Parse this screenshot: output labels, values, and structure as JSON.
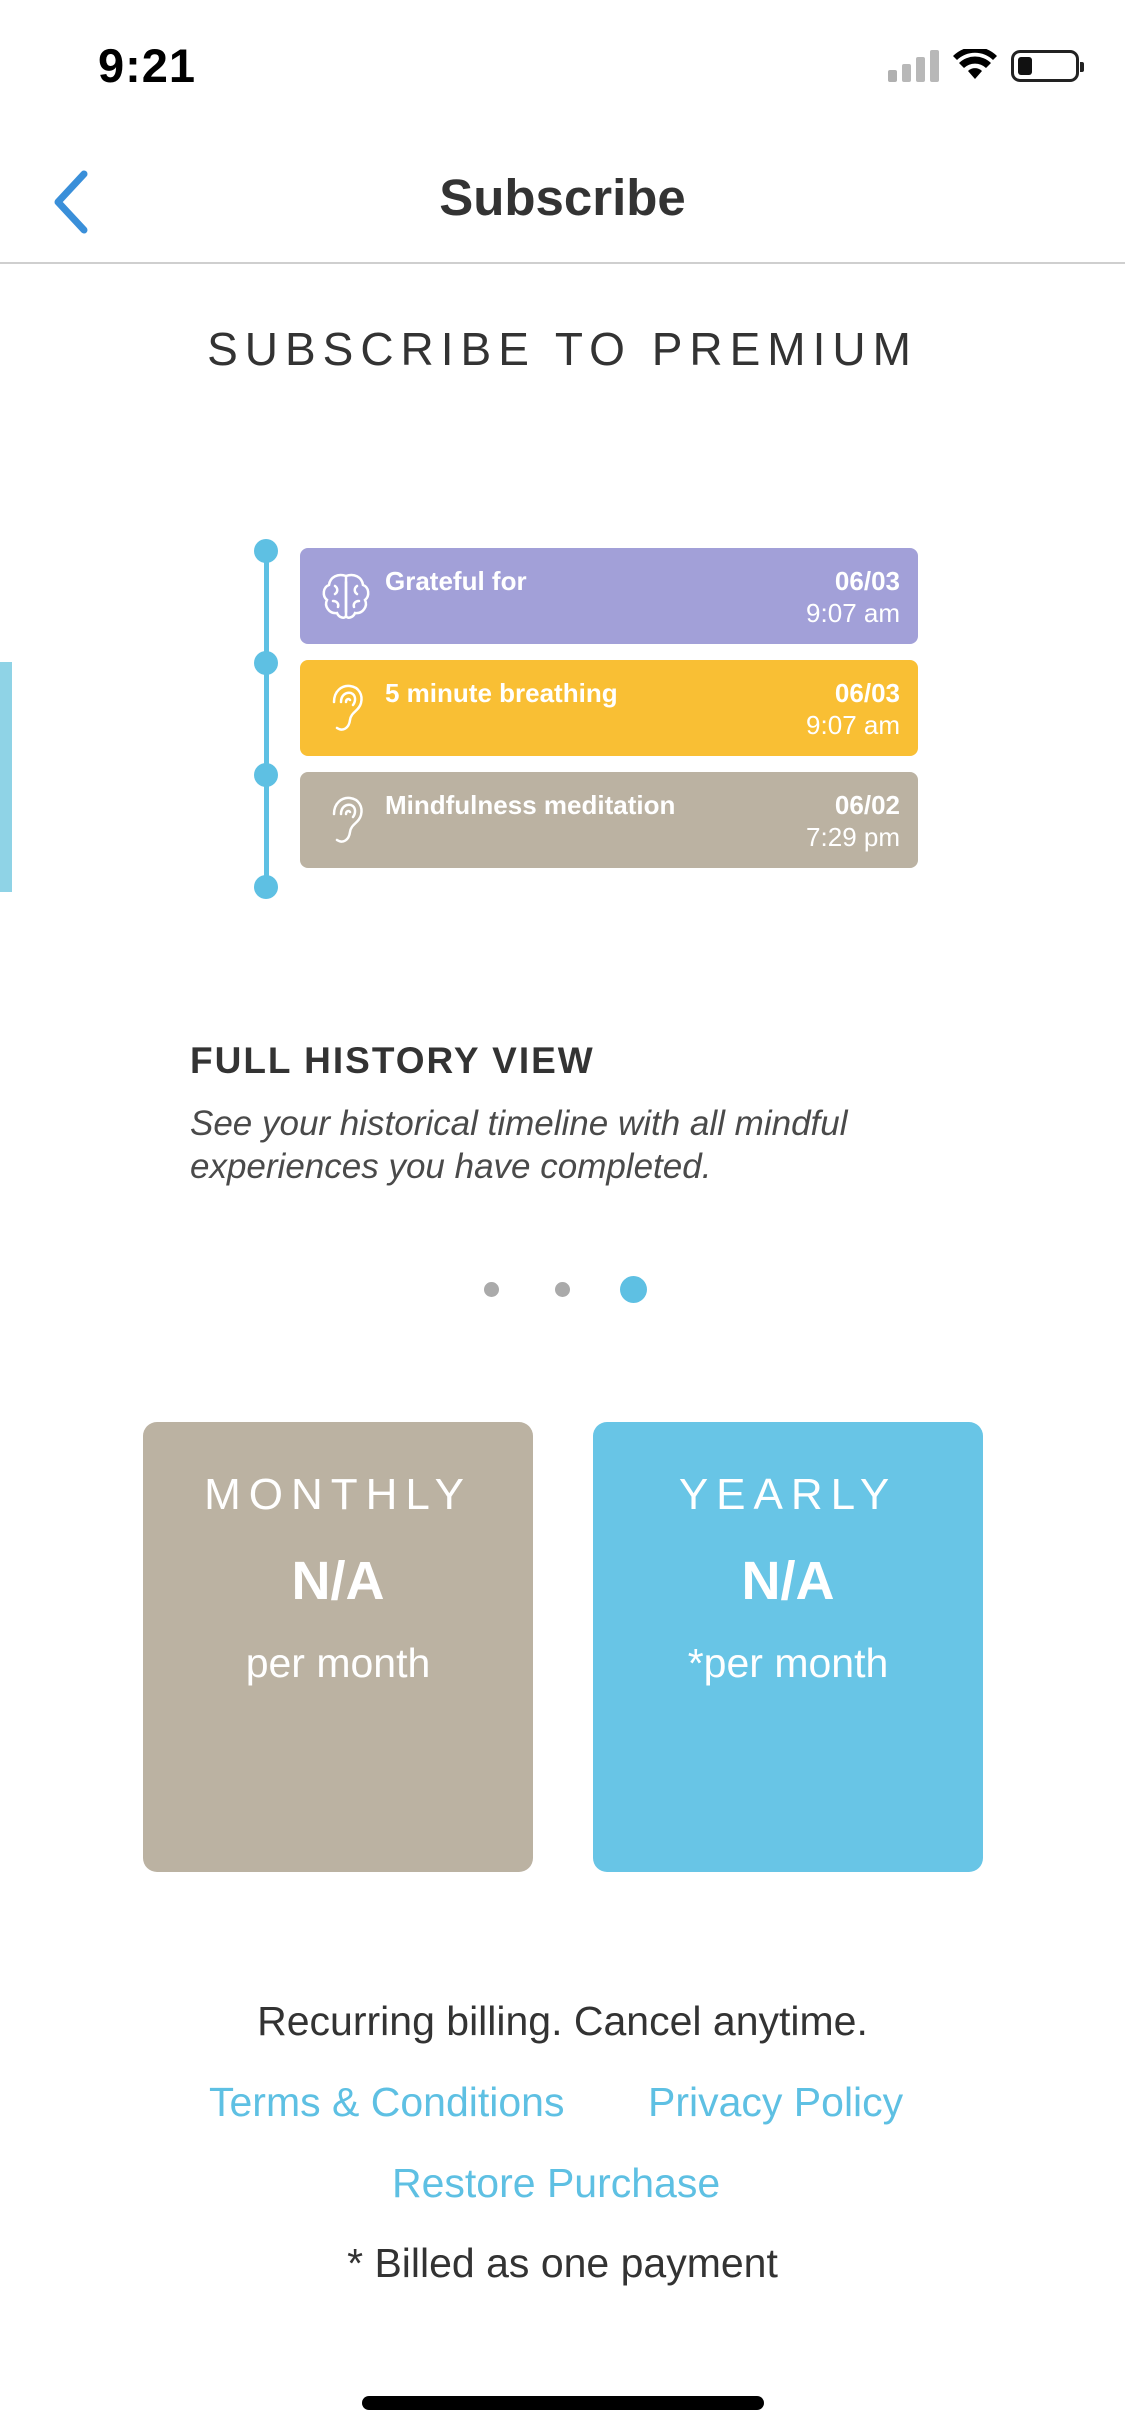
{
  "status_bar": {
    "time": "9:21"
  },
  "nav": {
    "title": "Subscribe"
  },
  "heading": "SUBSCRIBE TO PREMIUM",
  "timeline": {
    "items": [
      {
        "icon": "brain-icon",
        "title": "Grateful for",
        "date": "06/03",
        "time": "9:07 am",
        "color": "#a2a0d8"
      },
      {
        "icon": "ear-icon",
        "title": "5 minute breathing",
        "date": "06/03",
        "time": "9:07 am",
        "color": "#f9bf34"
      },
      {
        "icon": "ear-icon",
        "title": "Mindfulness meditation",
        "date": "06/02",
        "time": "7:29 pm",
        "color": "#bbb2a2"
      }
    ]
  },
  "feature": {
    "title": "FULL HISTORY VIEW",
    "description": "See your historical timeline with all mindful experiences you have completed."
  },
  "pager": {
    "count": 3,
    "active_index": 2
  },
  "plans": [
    {
      "name": "MONTHLY",
      "price": "N/A",
      "unit": "per month",
      "color": "#bbb2a2"
    },
    {
      "name": "YEARLY",
      "price": "N/A",
      "unit": "*per month",
      "color": "#68c5e6"
    }
  ],
  "footer": {
    "billing_note": "Recurring billing. Cancel anytime.",
    "terms_label": "Terms & Conditions",
    "privacy_label": "Privacy Policy",
    "restore_label": "Restore Purchase",
    "footnote": "* Billed as one payment"
  },
  "colors": {
    "accent": "#5ec0e3",
    "back_arrow": "#3a8fd9"
  }
}
